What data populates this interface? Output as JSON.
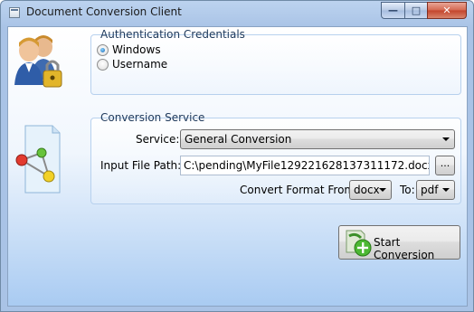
{
  "window": {
    "title": "Document Conversion Client",
    "minimize_glyph": "—",
    "maximize_glyph": "□",
    "close_glyph": "✕"
  },
  "auth": {
    "legend": "Authentication Credentials",
    "options": [
      {
        "label": "Windows",
        "checked": true
      },
      {
        "label": "Username",
        "checked": false
      }
    ]
  },
  "conversion": {
    "legend": "Conversion Service",
    "service_label": "Service:",
    "service_value": "General Conversion",
    "path_label": "Input File Path:",
    "path_value": "C:\\pending\\MyFile129221628137311172.docx",
    "browse_label": "...",
    "from_label": "Convert Format From:",
    "from_value": "docx",
    "to_label": "To:",
    "to_value": "pdf"
  },
  "actions": {
    "start_label": "Start Conversion"
  },
  "icons": {
    "users": "users-lock-icon",
    "document": "document-share-icon",
    "start": "convert-add-icon"
  },
  "colors": {
    "title_bar": "#a9c3e6",
    "client_gradient_bottom": "#a9cbf2",
    "group_legend": "#1e395b",
    "close_button": "#c3432b"
  }
}
